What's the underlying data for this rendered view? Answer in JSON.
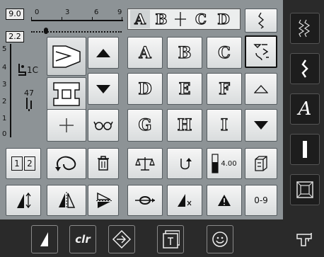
{
  "stitch_width": {
    "value": "9.0",
    "scale": [
      "0",
      "3",
      "6",
      "9"
    ]
  },
  "stitch_length": {
    "value": "2.2",
    "scale": [
      "5",
      "4",
      "3",
      "2",
      "1",
      "0"
    ]
  },
  "presser_foot": {
    "label": "1C"
  },
  "thread_tension": {
    "label": "47"
  },
  "tabs": [
    "A",
    "B",
    "C",
    "D"
  ],
  "letters": [
    "A",
    "B",
    "C",
    "D",
    "E",
    "F",
    "G",
    "H",
    "I"
  ],
  "balance_value": "4.00",
  "numbers_label": "0-9",
  "clear_label": "clr",
  "icons": {
    "delete": "trash-icon",
    "glasses": "glasses-icon",
    "pager_up": "triangle-up-icon",
    "pager_down": "triangle-down-icon"
  },
  "colors": {
    "panel": "#8d9396",
    "button": "#e9ebec",
    "background": "#2a2a2a"
  }
}
